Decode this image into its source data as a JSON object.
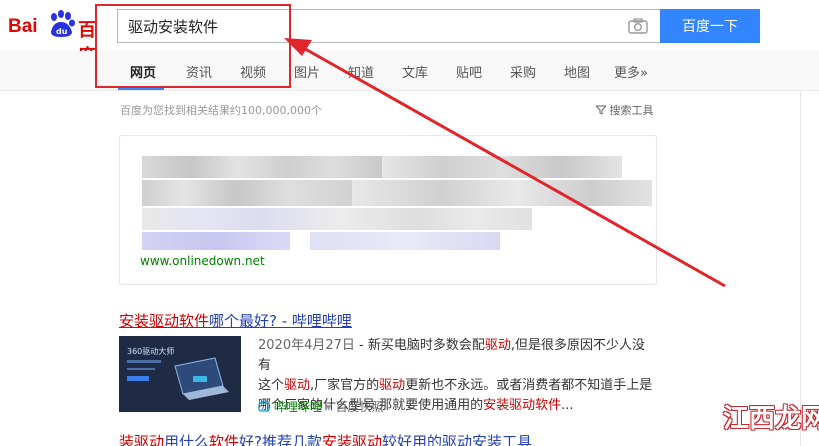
{
  "logo": {
    "bai": "Bai",
    "du_paw": "du",
    "baidu_cn": "百度"
  },
  "search": {
    "value": "驱动安装软件",
    "button": "百度一下"
  },
  "tabs": [
    {
      "label": "网页",
      "active": true
    },
    {
      "label": "资讯"
    },
    {
      "label": "视频"
    },
    {
      "label": "图片"
    },
    {
      "label": "知道"
    },
    {
      "label": "文库"
    },
    {
      "label": "贴吧"
    },
    {
      "label": "采购"
    },
    {
      "label": "地图"
    },
    {
      "label": "更多»"
    }
  ],
  "results_info": {
    "count": "百度为您找到相关结果约100,000,000个",
    "tools": "搜索工具"
  },
  "ad": {
    "url": "www.onlinedown.net"
  },
  "result1": {
    "title_red": "安装驱动软件",
    "title_rest": "哪个最好? - 哔哩哔哩",
    "thumb_text": "360驱动大师",
    "line1_date": "2020年4月27日",
    "line1_a": " - 新买电脑时多数会配",
    "line1_red": "驱动",
    "line1_b": ",但是很多原因不少人没有",
    "line2_a": "这个",
    "line2_red1": "驱动",
    "line2_b": ",厂家官方的",
    "line2_red2": "驱动",
    "line2_c": "更新也不永远。或者消费者都不知道手上是",
    "line3_a": "哪个厂家的什么型号,那就要使用通用的",
    "line3_red": "安装驱动软件",
    "line3_b": "...",
    "source": "哔哩哔哩",
    "snapshot": "百度快照"
  },
  "result2": {
    "t1": "装驱动",
    "t2": "用什么",
    "t3": "软件",
    "t4": "好?推荐几款",
    "t5": "安装驱动",
    "t6": "较好用的驱动安装工具"
  },
  "watermark": {
    "text": "江西龙网"
  },
  "colors": {
    "accent": "#3385ff",
    "annotation": "#e0252b",
    "link": "#2440b3",
    "highlight": "#c00000"
  }
}
